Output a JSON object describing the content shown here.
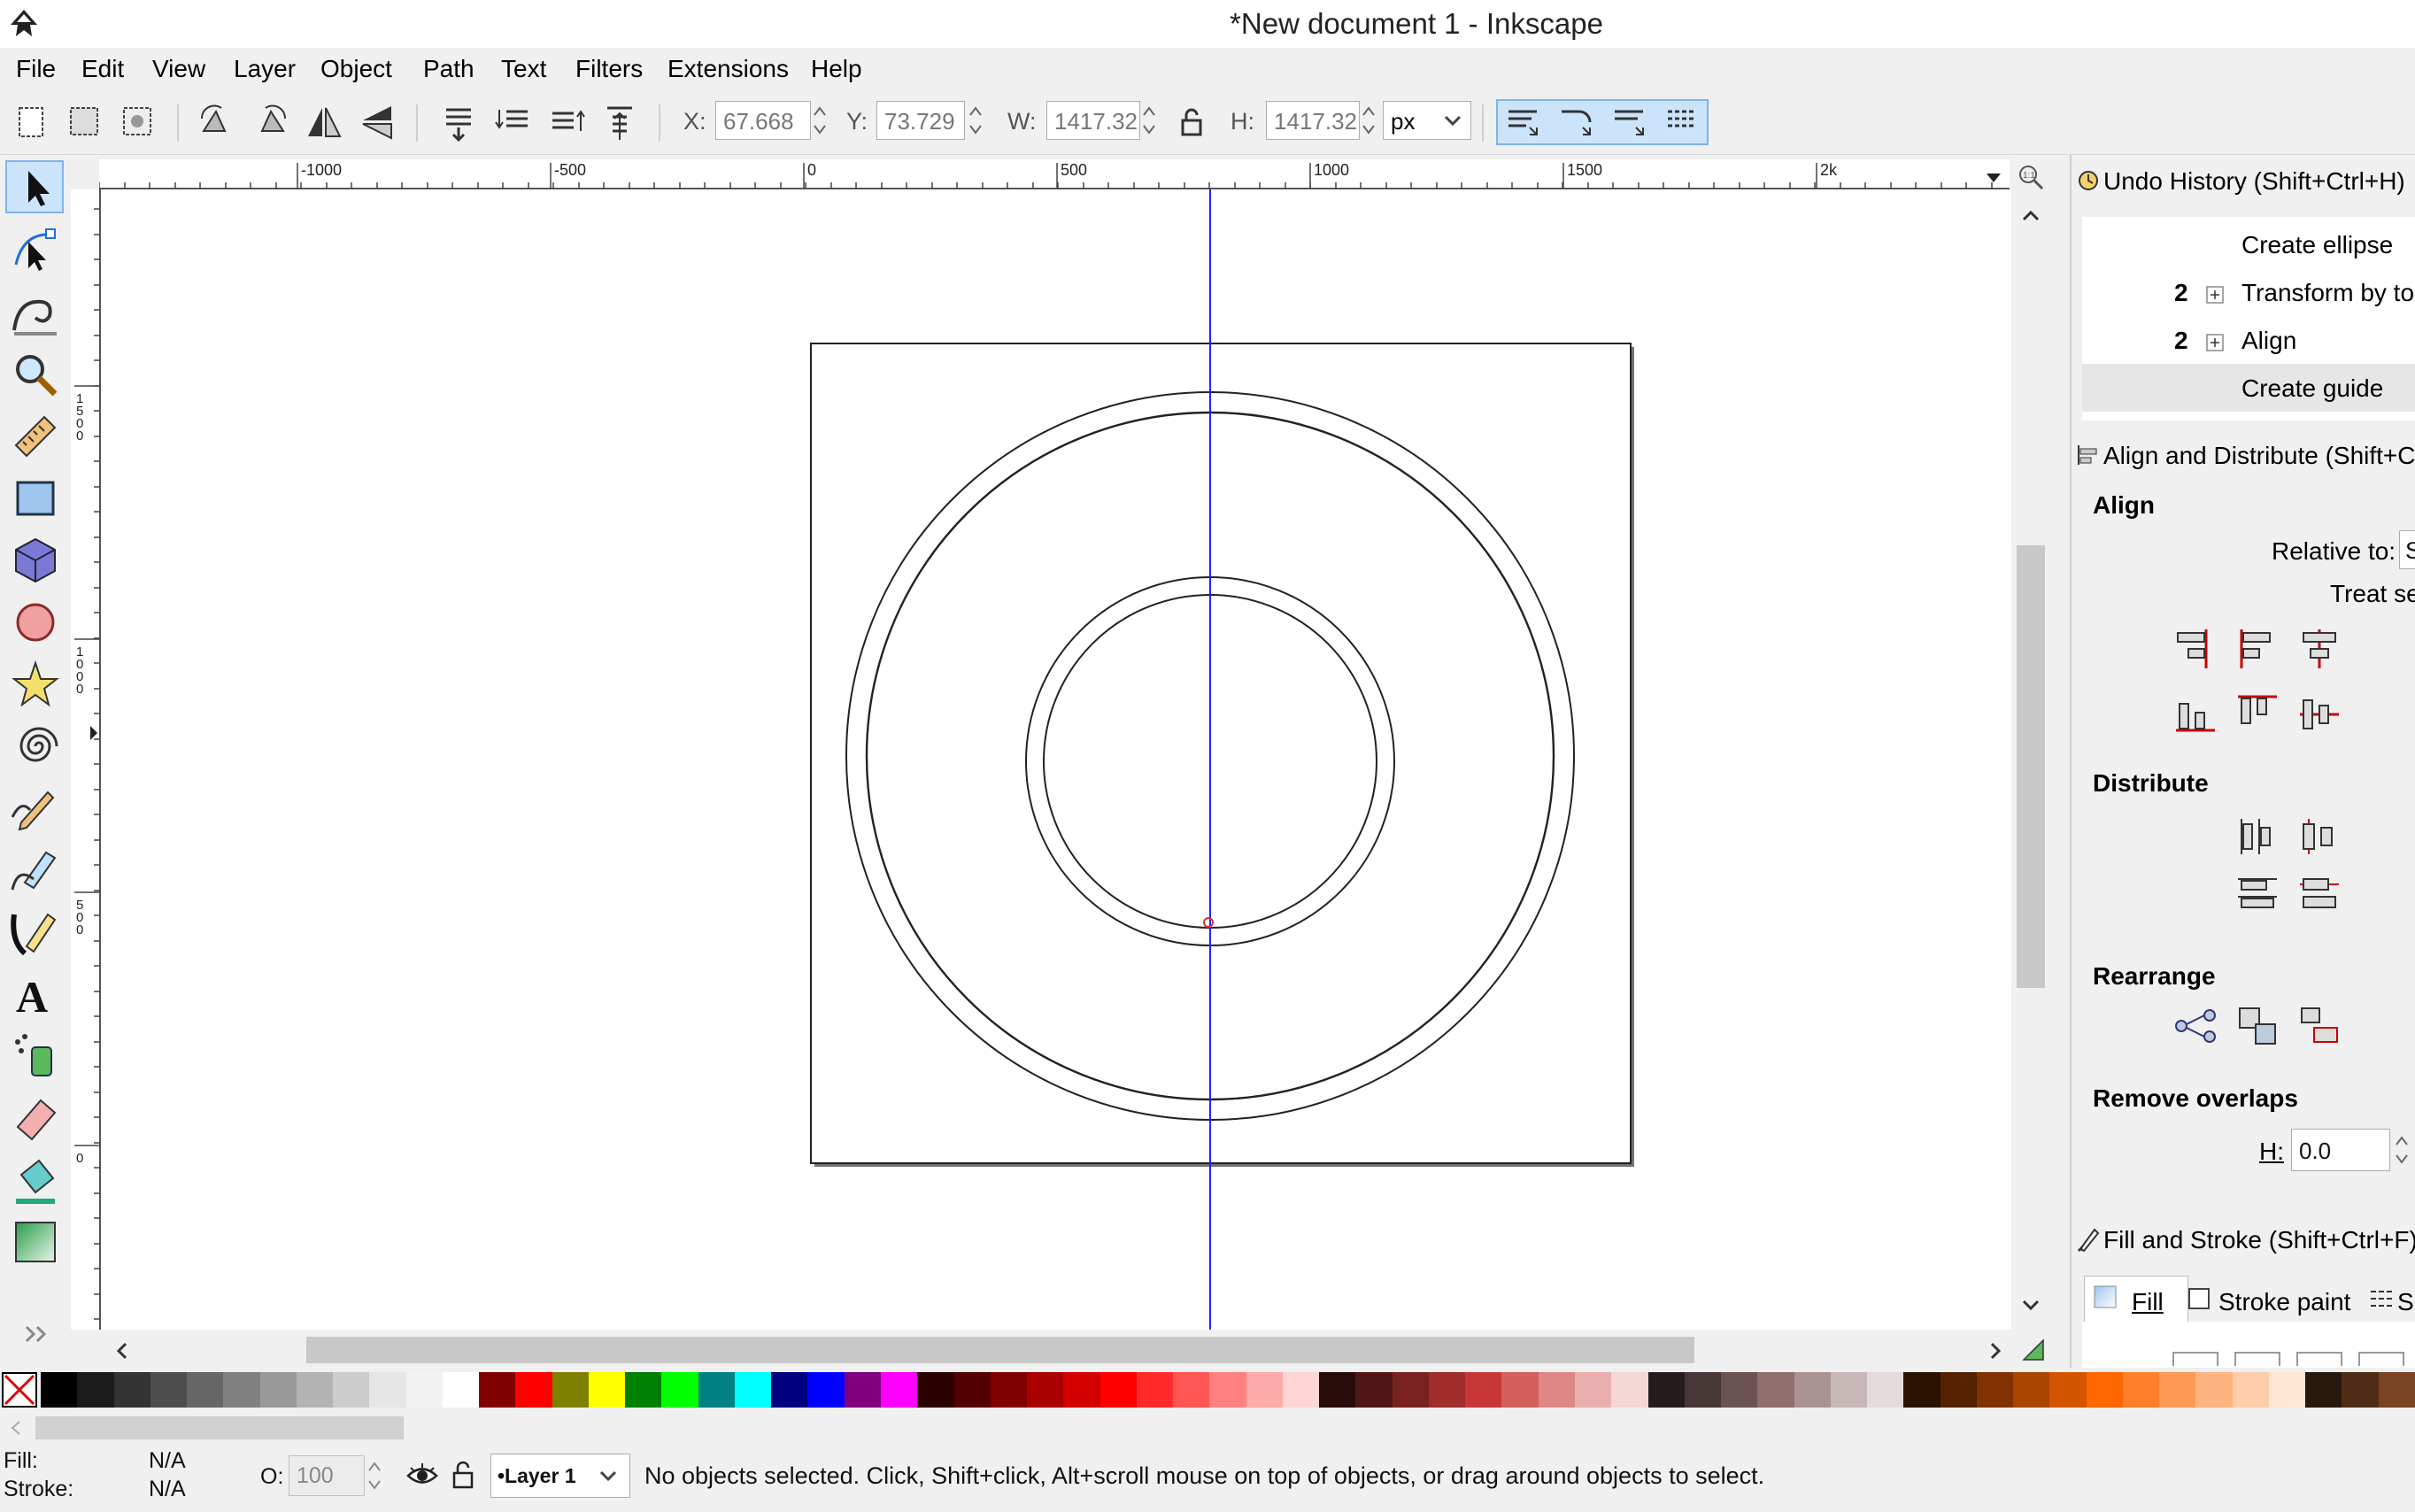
{
  "window": {
    "title": "*New document 1 - Inkscape"
  },
  "menu": [
    "File",
    "Edit",
    "View",
    "Layer",
    "Object",
    "Path",
    "Text",
    "Filters",
    "Extensions",
    "Help"
  ],
  "toolbar": {
    "x_label": "X:",
    "x_value": "67.668",
    "y_label": "Y:",
    "y_value": "73.729",
    "w_label": "W:",
    "w_value": "1417.32",
    "h_label": "H:",
    "h_value": "1417.32",
    "unit": "px"
  },
  "ruler": {
    "h_ticks": [
      "-1000",
      "-500",
      "0",
      "500",
      "1000",
      "1500",
      "2k"
    ],
    "v_ticks": [
      "1500",
      "1000",
      "500",
      "0"
    ]
  },
  "undo_history": {
    "title": "Undo History (Shift+Ctrl+H)",
    "items": [
      {
        "count": "",
        "label": "Create ellipse"
      },
      {
        "count": "2",
        "label": "Transform by to"
      },
      {
        "count": "2",
        "label": "Align"
      },
      {
        "count": "",
        "label": "Create guide"
      }
    ]
  },
  "align": {
    "title": "Align and Distribute (Shift+C",
    "align_heading": "Align",
    "relative_to_label": "Relative to:",
    "relative_to_value": "S",
    "treat_label": "Treat se",
    "distribute_heading": "Distribute",
    "rearrange_heading": "Rearrange",
    "remove_overlaps_heading": "Remove overlaps",
    "h_label": "H:",
    "h_value": "0.0"
  },
  "fill_stroke": {
    "title": "Fill and Stroke (Shift+Ctrl+F)",
    "tabs": [
      "Fill",
      "Stroke paint",
      "S"
    ]
  },
  "statusbar": {
    "fill_label": "Fill:",
    "fill_value": "N/A",
    "stroke_label": "Stroke:",
    "stroke_value": "N/A",
    "opacity_label": "O:",
    "opacity_value": "100",
    "layer": "•Layer 1",
    "message": "No objects selected. Click, Shift+click, Alt+scroll mouse on top of objects, or drag around objects to select."
  },
  "colors": {
    "accent": "#3399ff",
    "guide": "#2222ff",
    "palette": [
      "#000000",
      "#1a1a1a",
      "#333333",
      "#4d4d4d",
      "#666666",
      "#808080",
      "#999999",
      "#b3b3b3",
      "#cccccc",
      "#e6e6e6",
      "#f2f2f2",
      "#ffffff",
      "#800000",
      "#ff0000",
      "#808000",
      "#ffff00",
      "#008000",
      "#00ff00",
      "#008080",
      "#00ffff",
      "#000080",
      "#0000ff",
      "#800080",
      "#ff00ff",
      "#2b0000",
      "#550000",
      "#800000",
      "#aa0000",
      "#d40000",
      "#ff0000",
      "#ff2a2a",
      "#ff5555",
      "#ff8080",
      "#ffaaaa",
      "#ffd5d5",
      "#280b0b",
      "#501616",
      "#782121",
      "#a02c2c",
      "#c83737",
      "#d35f5f",
      "#de8787",
      "#e9afaf",
      "#f4d7d7",
      "#241c1c",
      "#483737",
      "#6c5353",
      "#916f6f",
      "#ac9393",
      "#c8b7b7",
      "#e3dbdb",
      "#2b1100",
      "#552200",
      "#803300",
      "#aa4400",
      "#d45500",
      "#ff6600",
      "#ff7f2a",
      "#ff9955",
      "#ffb380",
      "#ffccaa",
      "#ffe6d5",
      "#28170b",
      "#502d16",
      "#784421"
    ]
  },
  "icons": {
    "menu_bar": "none",
    "tools": [
      "selector-arrow-icon",
      "node-tool-icon",
      "tweak-tool-icon",
      "zoom-icon",
      "measure-icon",
      "rectangle-icon",
      "3d-box-icon",
      "ellipse-icon",
      "star-icon",
      "spiral-icon",
      "pencil-icon",
      "pen-icon",
      "calligraphy-icon",
      "text-icon",
      "spray-icon",
      "eraser-icon",
      "paint-bucket-icon",
      "gradient-icon"
    ]
  }
}
